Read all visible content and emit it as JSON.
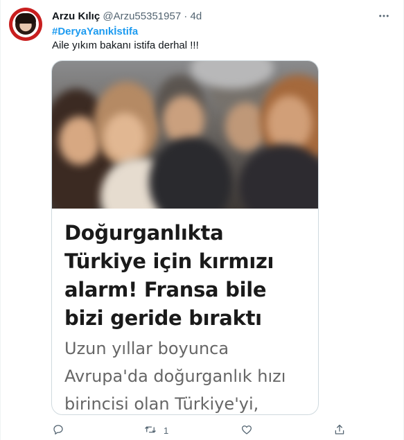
{
  "tweet": {
    "author_name": "Arzu Kılıç",
    "handle": "@Arzu55351957",
    "separator": "·",
    "time": "4d",
    "hashtag": "#DeryaYanıkİstifa",
    "text": "Aile yıkım bakanı istifa derhal !!!"
  },
  "card": {
    "headline": "Doğurganlıkta Türkiye için kırmızı alarm! Fransa bile bizi geride bıraktı",
    "body": "Uzun yıllar boyunca Avrupa'da doğurganlık hızı birincisi olan Türkiye'yi,"
  },
  "actions": {
    "reply_count": "",
    "retweet_count": "1",
    "like_count": "",
    "share_count": ""
  },
  "colors": {
    "link": "#1d9bf0",
    "secondary_text": "#536471",
    "border": "#cfd9de",
    "avatar_ring": "#c81e1e"
  },
  "icons": [
    "more-icon",
    "reply-icon",
    "retweet-icon",
    "like-icon",
    "share-icon"
  ]
}
